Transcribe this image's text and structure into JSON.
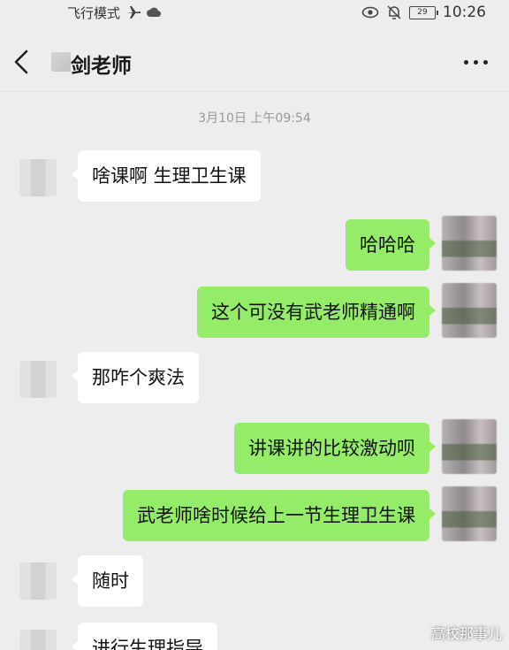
{
  "status_bar": {
    "airplane_mode": "飞行模式",
    "battery": "29",
    "time": "10:26",
    "icons": [
      "airplane-icon",
      "cloud-icon",
      "eye-icon",
      "bell-off-icon",
      "battery-icon"
    ]
  },
  "header": {
    "title": "剑老师",
    "back_icon": "chevron-left-icon",
    "more_icon": "more-dots-icon"
  },
  "timestamp": "3月10日 上午09:54",
  "messages": [
    {
      "side": "in",
      "text": "啥课啊 生理卫生课"
    },
    {
      "side": "out",
      "text": "哈哈哈"
    },
    {
      "side": "out",
      "text": "这个可没有武老师精通啊"
    },
    {
      "side": "in",
      "text": "那咋个爽法"
    },
    {
      "side": "out",
      "text": "讲课讲的比较激动呗"
    },
    {
      "side": "out",
      "text": "武老师啥时候给上一节生理卫生课"
    },
    {
      "side": "in",
      "text": "随时"
    },
    {
      "side": "in",
      "text": "进行生理指导"
    }
  ],
  "watermark": "高校那事儿",
  "colors": {
    "background": "#ededed",
    "outgoing_bubble": "#95ec69",
    "incoming_bubble": "#ffffff"
  }
}
